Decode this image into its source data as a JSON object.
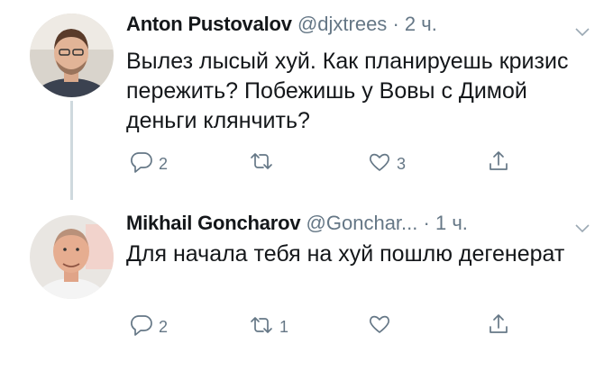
{
  "tweets": [
    {
      "name": "Anton Pustovalov",
      "handle": "@djxtrees",
      "separator": "·",
      "time": "2 ч.",
      "text": "Вылез лысый хуй. Как планируешь кризис пережить? Побежишь у Вовы с Димой деньги клянчить?",
      "reply_count": "2",
      "retweet_count": "",
      "like_count": "3"
    },
    {
      "name": "Mikhail Goncharov",
      "handle": "@Gonchar...",
      "separator": "·",
      "time": "1 ч.",
      "text": "Для начала тебя на хуй пошлю дегенерат",
      "reply_count": "2",
      "retweet_count": "1",
      "like_count": ""
    }
  ],
  "colors": {
    "text": "#14171a",
    "secondary": "#657786",
    "thread_line": "#cfd9de"
  },
  "icons": [
    "reply-icon",
    "retweet-icon",
    "like-icon",
    "share-icon",
    "chevron-down-icon"
  ]
}
